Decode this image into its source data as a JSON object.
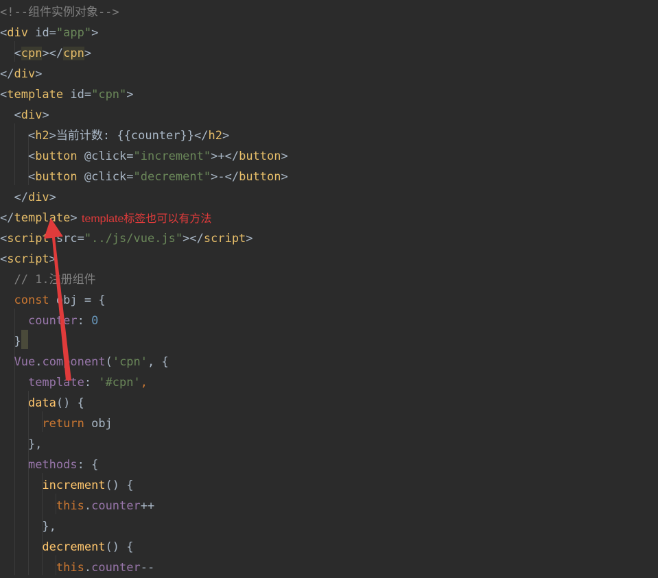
{
  "editor": {
    "lines": [
      [
        {
          "t": "<!--组件实例对象-->",
          "c": "comment"
        }
      ],
      [
        {
          "t": "<",
          "c": "tagbr"
        },
        {
          "t": "div",
          "c": "tag"
        },
        {
          "t": " id=",
          "c": "attr"
        },
        {
          "t": "\"app\"",
          "c": "str"
        },
        {
          "t": ">",
          "c": "tagbr"
        }
      ],
      [
        {
          "t": "  <",
          "c": "tagbr"
        },
        {
          "t": "cpn",
          "c": "tag",
          "hl": true
        },
        {
          "t": "></",
          "c": "tagbr"
        },
        {
          "t": "cpn",
          "c": "tag",
          "hl": true
        },
        {
          "t": ">",
          "c": "tagbr"
        }
      ],
      [
        {
          "t": "</",
          "c": "tagbr"
        },
        {
          "t": "div",
          "c": "tag"
        },
        {
          "t": ">",
          "c": "tagbr"
        }
      ],
      [
        {
          "t": "<",
          "c": "tagbr"
        },
        {
          "t": "template",
          "c": "tag"
        },
        {
          "t": " id=",
          "c": "attr"
        },
        {
          "t": "\"cpn\"",
          "c": "str"
        },
        {
          "t": ">",
          "c": "tagbr"
        }
      ],
      [
        {
          "t": "  <",
          "c": "tagbr"
        },
        {
          "t": "div",
          "c": "tag"
        },
        {
          "t": ">",
          "c": "tagbr"
        }
      ],
      [
        {
          "t": "    <",
          "c": "tagbr"
        },
        {
          "t": "h2",
          "c": "tag"
        },
        {
          "t": ">",
          "c": "tagbr"
        },
        {
          "t": "当前计数: {{counter}}",
          "c": "default"
        },
        {
          "t": "</",
          "c": "tagbr"
        },
        {
          "t": "h2",
          "c": "tag"
        },
        {
          "t": ">",
          "c": "tagbr"
        }
      ],
      [
        {
          "t": "    <",
          "c": "tagbr"
        },
        {
          "t": "button",
          "c": "tag"
        },
        {
          "t": " @click=",
          "c": "attr"
        },
        {
          "t": "\"increment\"",
          "c": "str"
        },
        {
          "t": ">",
          "c": "tagbr"
        },
        {
          "t": "+",
          "c": "default"
        },
        {
          "t": "</",
          "c": "tagbr"
        },
        {
          "t": "button",
          "c": "tag"
        },
        {
          "t": ">",
          "c": "tagbr"
        }
      ],
      [
        {
          "t": "    <",
          "c": "tagbr"
        },
        {
          "t": "button",
          "c": "tag"
        },
        {
          "t": " @click=",
          "c": "attr"
        },
        {
          "t": "\"decrement\"",
          "c": "str"
        },
        {
          "t": ">",
          "c": "tagbr"
        },
        {
          "t": "-",
          "c": "default"
        },
        {
          "t": "</",
          "c": "tagbr"
        },
        {
          "t": "button",
          "c": "tag"
        },
        {
          "t": ">",
          "c": "tagbr"
        }
      ],
      [
        {
          "t": "  </",
          "c": "tagbr"
        },
        {
          "t": "div",
          "c": "tag"
        },
        {
          "t": ">",
          "c": "tagbr"
        }
      ],
      [
        {
          "t": "</",
          "c": "tagbr"
        },
        {
          "t": "template",
          "c": "tag"
        },
        {
          "t": ">",
          "c": "tagbr"
        }
      ],
      [
        {
          "t": "<",
          "c": "tagbr"
        },
        {
          "t": "script",
          "c": "tag"
        },
        {
          "t": " src=",
          "c": "attr"
        },
        {
          "t": "\"../js/vue.js\"",
          "c": "str"
        },
        {
          "t": "></",
          "c": "tagbr"
        },
        {
          "t": "script",
          "c": "tag"
        },
        {
          "t": ">",
          "c": "tagbr"
        }
      ],
      [
        {
          "t": "<",
          "c": "tagbr"
        },
        {
          "t": "script",
          "c": "tag"
        },
        {
          "t": ">",
          "c": "tagbr"
        }
      ],
      [
        {
          "t": "  // 1.注册组件",
          "c": "comment"
        }
      ],
      [
        {
          "t": "  ",
          "c": "default"
        },
        {
          "t": "const",
          "c": "kw"
        },
        {
          "t": " obj = {",
          "c": "default"
        }
      ],
      [
        {
          "t": "    ",
          "c": "default"
        },
        {
          "t": "counter",
          "c": "prop"
        },
        {
          "t": ": ",
          "c": "default"
        },
        {
          "t": "0",
          "c": "num"
        }
      ],
      [
        {
          "t": "  }",
          "c": "default"
        }
      ],
      [
        {
          "t": "  ",
          "c": "default"
        },
        {
          "t": "Vue",
          "c": "prop"
        },
        {
          "t": ".",
          "c": "default"
        },
        {
          "t": "component",
          "c": "prop"
        },
        {
          "t": "(",
          "c": "default"
        },
        {
          "t": "'cpn'",
          "c": "str"
        },
        {
          "t": ", {",
          "c": "default"
        }
      ],
      [
        {
          "t": "    ",
          "c": "default"
        },
        {
          "t": "template",
          "c": "prop"
        },
        {
          "t": ": ",
          "c": "default"
        },
        {
          "t": "'#cpn'",
          "c": "str"
        },
        {
          "t": ",",
          "c": "kw"
        }
      ],
      [
        {
          "t": "    ",
          "c": "default"
        },
        {
          "t": "data",
          "c": "fn"
        },
        {
          "t": "() {",
          "c": "default"
        }
      ],
      [
        {
          "t": "      ",
          "c": "default"
        },
        {
          "t": "return",
          "c": "kw"
        },
        {
          "t": " obj",
          "c": "default"
        }
      ],
      [
        {
          "t": "    },",
          "c": "default"
        }
      ],
      [
        {
          "t": "    ",
          "c": "default"
        },
        {
          "t": "methods",
          "c": "prop"
        },
        {
          "t": ": {",
          "c": "default"
        }
      ],
      [
        {
          "t": "      ",
          "c": "default"
        },
        {
          "t": "increment",
          "c": "fn"
        },
        {
          "t": "() {",
          "c": "default"
        }
      ],
      [
        {
          "t": "        ",
          "c": "default"
        },
        {
          "t": "this",
          "c": "this"
        },
        {
          "t": ".",
          "c": "default"
        },
        {
          "t": "counter",
          "c": "field"
        },
        {
          "t": "++",
          "c": "default"
        }
      ],
      [
        {
          "t": "      },",
          "c": "default"
        }
      ],
      [
        {
          "t": "      ",
          "c": "default"
        },
        {
          "t": "decrement",
          "c": "fn"
        },
        {
          "t": "() {",
          "c": "default"
        }
      ],
      [
        {
          "t": "        ",
          "c": "default"
        },
        {
          "t": "this",
          "c": "this"
        },
        {
          "t": ".",
          "c": "default"
        },
        {
          "t": "counter",
          "c": "field"
        },
        {
          "t": "--",
          "c": "default"
        }
      ]
    ]
  },
  "annotation": {
    "text": "template标签也可以有方法",
    "color": "#e03b3b"
  },
  "theme": {
    "background": "#2b2b2b"
  }
}
